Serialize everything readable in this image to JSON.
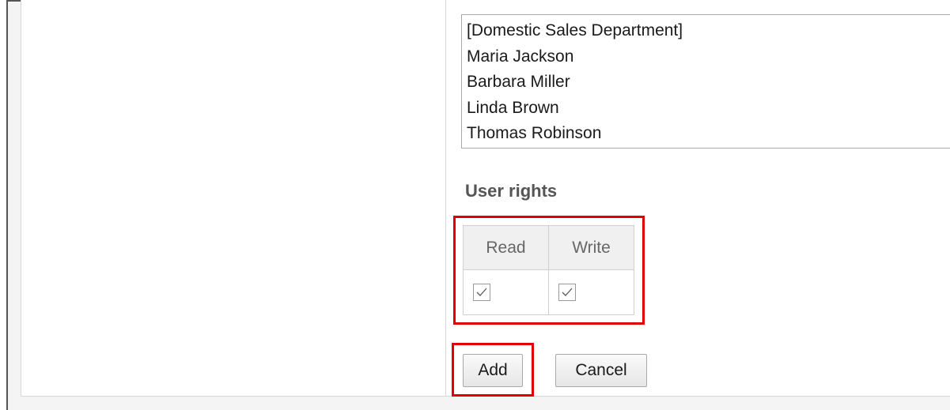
{
  "members": {
    "items": [
      "[Domestic Sales Department]",
      "Maria Jackson",
      "Barbara Miller",
      "Linda Brown",
      "Thomas Robinson"
    ]
  },
  "user_rights": {
    "heading": "User rights",
    "columns": [
      "Read",
      "Write"
    ],
    "read_checked": true,
    "write_checked": true,
    "checkbox_icon": "check-icon"
  },
  "actions": {
    "add_label": "Add",
    "cancel_label": "Cancel"
  },
  "colors": {
    "highlight": "#e00000",
    "heading_text": "#555555",
    "table_header_bg": "#f0f0f0"
  }
}
